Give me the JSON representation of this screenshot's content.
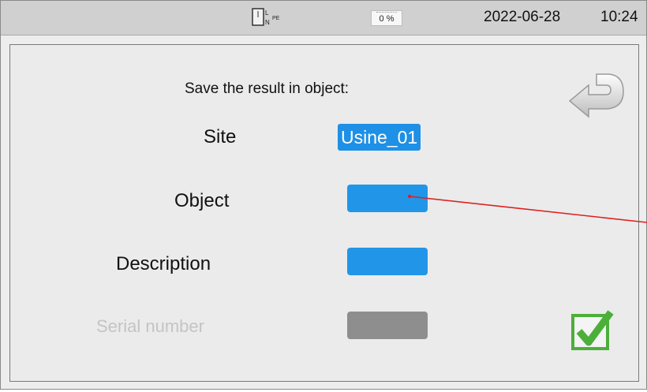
{
  "status_bar": {
    "connection_icon": "l-n-pe-connection-icon",
    "connection_label_l": "L",
    "connection_label_n": "N",
    "connection_label_pe": "PE",
    "battery_icon": "battery-icon",
    "battery_level": "0 %",
    "date": "2022-06-28",
    "time": "10:24"
  },
  "dialog": {
    "prompt": "Save the result in object:",
    "fields": {
      "site_label": "Site",
      "site_value": "Usine_01",
      "object_label": "Object",
      "object_value": "",
      "description_label": "Description",
      "description_value": "",
      "serial_label": "Serial number",
      "serial_value": ""
    },
    "back_icon": "return-arrow-icon",
    "confirm_icon": "checkmark-icon"
  },
  "colors": {
    "field_blue": "#2196e8",
    "field_disabled": "#8e8e8e",
    "confirm_green": "#4caf3a",
    "pointer_red": "#e02020"
  }
}
